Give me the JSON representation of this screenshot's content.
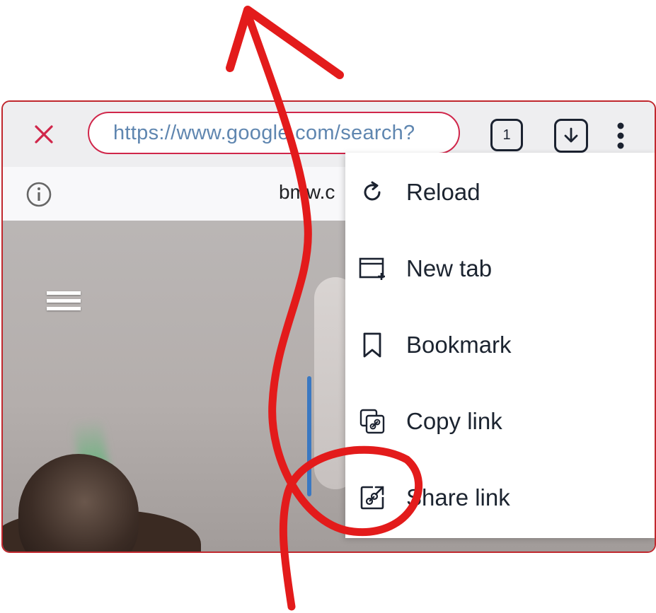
{
  "toolbar": {
    "url": "https://www.google.com/search?",
    "tab_count": "1",
    "close_icon": "close-icon",
    "download_icon": "download-icon",
    "more_icon": "more-vert-icon"
  },
  "info_bar": {
    "domain": "bmw.c",
    "icon": "info-icon"
  },
  "menu": {
    "items": [
      {
        "label": "Reload",
        "icon": "reload-icon"
      },
      {
        "label": "New tab",
        "icon": "new-tab-icon"
      },
      {
        "label": "Bookmark",
        "icon": "bookmark-icon"
      },
      {
        "label": "Copy link",
        "icon": "copy-link-icon"
      },
      {
        "label": "Share link",
        "icon": "share-link-icon"
      }
    ]
  },
  "colors": {
    "accent": "#d0264a",
    "annotation": "#e31b1b",
    "url_text": "#5f86b0",
    "icon_dark": "#1b2230"
  }
}
